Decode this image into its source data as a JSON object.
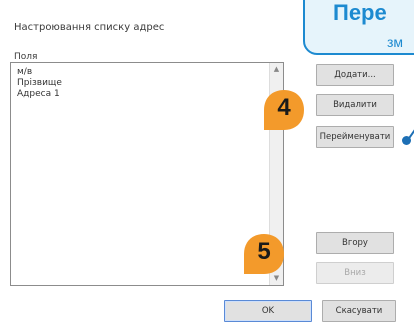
{
  "dialog": {
    "title": "Настроювання списку адрес",
    "field_label": "Поля",
    "fields": [
      "м/в",
      "Прізвище",
      "Адреса 1"
    ],
    "buttons": {
      "add": "Додати...",
      "delete": "Видалити",
      "rename": "Перейменувати",
      "up": "Вгору",
      "down": "Вниз",
      "ok": "OK",
      "cancel": "Скасувати"
    }
  },
  "banner": {
    "title": "Пере",
    "subtitle": "зм"
  },
  "steps": {
    "step4": "4",
    "step5": "5"
  },
  "colors": {
    "accent_blue": "#1d8ad0",
    "step_orange": "#f39a2b"
  }
}
